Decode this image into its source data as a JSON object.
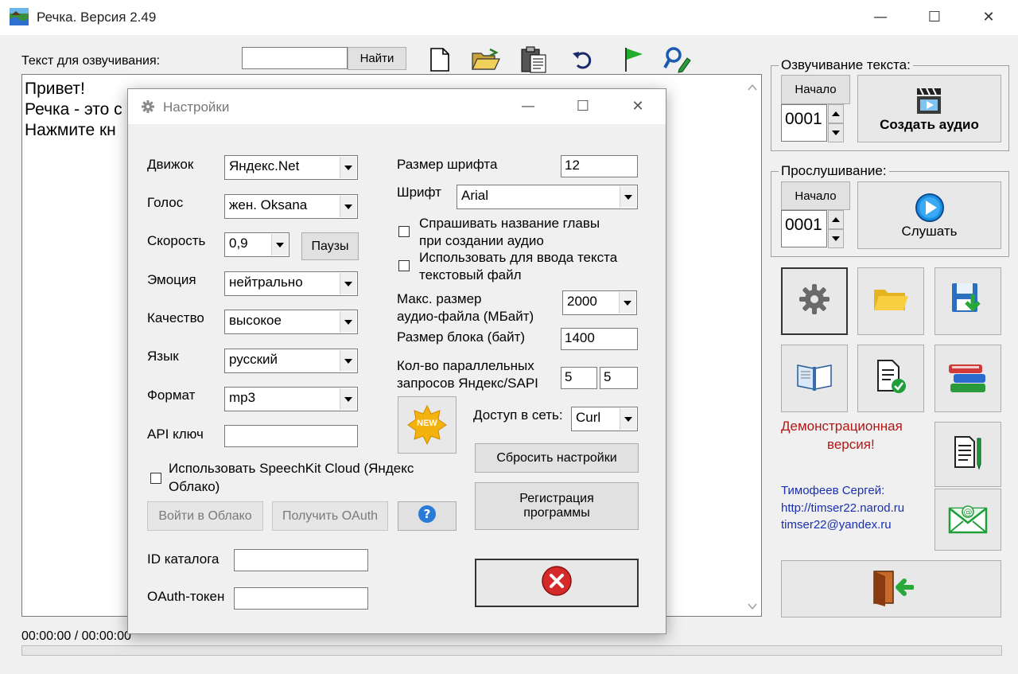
{
  "window": {
    "title": "Речка. Версия 2.49",
    "controls": {
      "minimize": "—",
      "maximize": "☐",
      "close": "✕"
    }
  },
  "toolbar": {
    "text_label": "Текст для озвучивания:",
    "search_value": "",
    "find_button": "Найти"
  },
  "editor": {
    "lines": [
      "Привет!",
      "Речка - это с",
      "Нажмите кн"
    ]
  },
  "status": {
    "time": "00:00:00 / 00:00:00"
  },
  "synthesis": {
    "group_title": "Озвучивание текста:",
    "start_label": "Начало",
    "start_value": "0001",
    "create_button": "Создать аудио"
  },
  "listening": {
    "group_title": "Прослушивание:",
    "start_label": "Начало",
    "start_value": "0001",
    "listen_button": "Слушать"
  },
  "sidebar": {
    "demo_text_1": "Демонстрационная",
    "demo_text_2": "версия!",
    "author_name": "Тимофеев Сергей:",
    "author_site": "http://timser22.narod.ru",
    "author_email": "timser22@yandex.ru"
  },
  "settings": {
    "title": "Настройки",
    "engine_label": "Движок",
    "engine_value": "Яндекс.Net",
    "voice_label": "Голос",
    "voice_value": "жен. Oksana",
    "speed_label": "Скорость",
    "speed_value": "0,9",
    "pauses_button": "Паузы",
    "emotion_label": "Эмоция",
    "emotion_value": "нейтрально",
    "quality_label": "Качество",
    "quality_value": "высокое",
    "language_label": "Язык",
    "language_value": "русский",
    "format_label": "Формат",
    "format_value": "mp3",
    "api_label": "API ключ",
    "api_value": "",
    "speechkit_line1": "Использовать SpeechKit Cloud (Яндекс",
    "speechkit_line2": "Облако)",
    "cloud_login_button": "Войти в Облако",
    "get_oauth_button": "Получить OAuth",
    "catalog_label": "ID каталога",
    "catalog_value": "",
    "oauth_label": "OAuth-токен",
    "oauth_value": "",
    "font_size_label": "Размер шрифта",
    "font_size_value": "12",
    "font_label": "Шрифт",
    "font_value": "Arial",
    "ask_chapter_line1": "Спрашивать название главы",
    "ask_chapter_line2": "при создании аудио",
    "use_file_line1": "Использовать для ввода текста",
    "use_file_line2": "текстовый файл",
    "max_size_line1": "Макс. размер",
    "max_size_line2": "аудио-файла (МБайт)",
    "max_size_value": "2000",
    "block_size_label": "Размер блока (байт)",
    "block_size_value": "1400",
    "parallel_line1": "Кол-во параллельных",
    "parallel_line2": "запросов Яндекс/SAPI",
    "parallel_yandex": "5",
    "parallel_sapi": "5",
    "new_badge": "NEW",
    "network_label": "Доступ в сеть:",
    "network_value": "Curl",
    "reset_button": "Сбросить настройки",
    "register_line1": "Регистрация",
    "register_line2": "программы"
  },
  "colors": {
    "demo_red": "#b01818",
    "author_blue": "#1a2fb0",
    "accent_blue": "#1e8fe0",
    "close_red": "#d42a2a"
  }
}
